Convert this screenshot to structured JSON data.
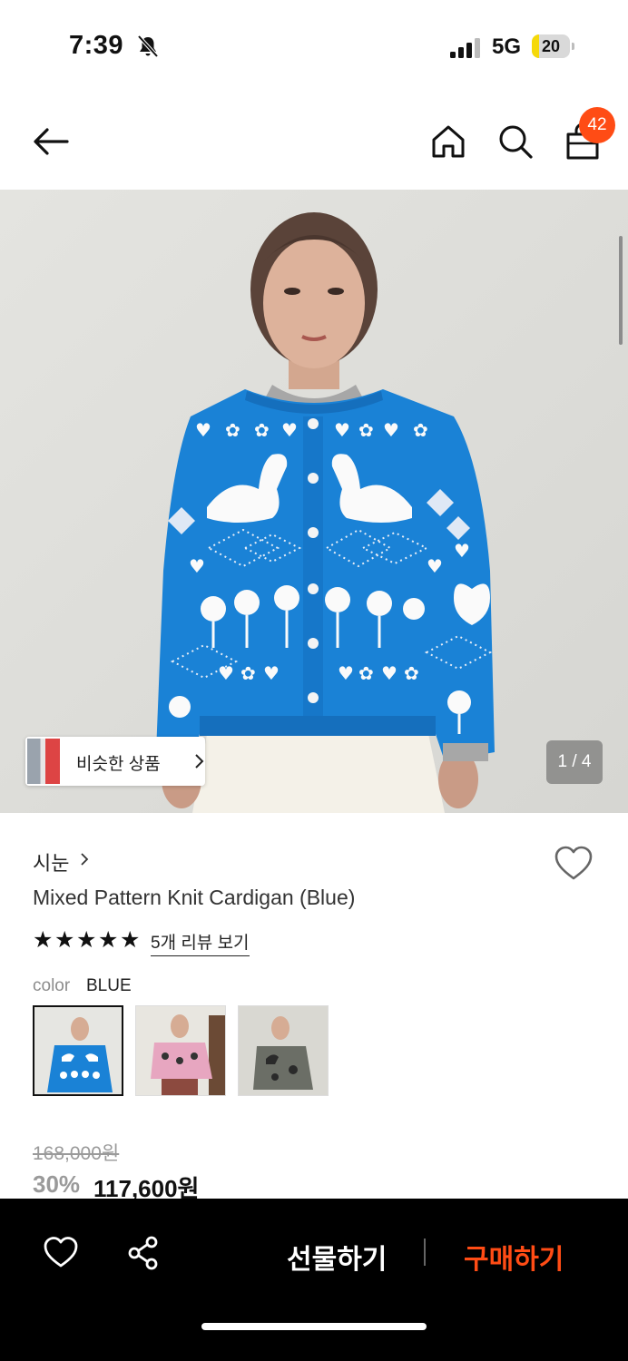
{
  "status_bar": {
    "time": "7:39",
    "network": "5G",
    "battery": "20",
    "battery_level": 0.2
  },
  "nav": {
    "cart_count": "42",
    "icons": [
      "back-arrow-icon",
      "home-icon",
      "search-icon",
      "shopping-bag-icon"
    ]
  },
  "gallery": {
    "similar_label": "비슷한 상품",
    "counter": "1 / 4"
  },
  "product": {
    "brand": "시눈",
    "name": "Mixed Pattern Knit Cardigan (Blue)",
    "rating_stars": 5,
    "review_link": "5개 리뷰 보기",
    "color_label": "color",
    "color_value": "BLUE",
    "color_options": [
      "blue",
      "pink",
      "charcoal"
    ],
    "original_price": "168,000원",
    "discount": "30%",
    "price": "117,600원"
  },
  "bottom_bar": {
    "gift_label": "선물하기",
    "buy_label": "구매하기"
  },
  "colors": {
    "accent": "#ff4c15",
    "knit_blue": "#1a82d6"
  }
}
